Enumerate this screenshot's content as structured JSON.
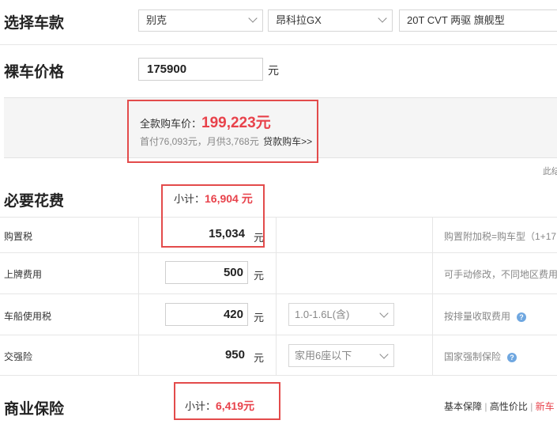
{
  "select_car": {
    "heading": "选择车款",
    "brand": "别克",
    "model": "昂科拉GX",
    "trim": "20T CVT 两驱 旗舰型"
  },
  "bare_price": {
    "heading": "裸车价格",
    "value": "175900",
    "unit": "元"
  },
  "total": {
    "label": "全款购车价：",
    "value": "199,223元",
    "sub": "首付76,093元，月供3,768元",
    "loan_link": "贷款购车>>",
    "side_note": "此结"
  },
  "necessary": {
    "heading": "必要花费",
    "subtotal_label": "小计：",
    "subtotal_value": "16,904 元",
    "rows": [
      {
        "label": "购置税",
        "value": "15,034",
        "unit": "元",
        "note": "购置附加税=购车型（1+17"
      },
      {
        "label": "上牌费用",
        "value": "500",
        "unit": "元",
        "note": "可手动修改，不同地区费用"
      },
      {
        "label": "车船使用税",
        "value": "420",
        "unit": "元",
        "option": "1.0-1.6L(含)",
        "note": "按排量收取费用"
      },
      {
        "label": "交强险",
        "value": "950",
        "unit": "元",
        "option": "家用6座以下",
        "note": "国家强制保险"
      }
    ]
  },
  "commercial": {
    "heading": "商业保险",
    "subtotal_label": "小计：",
    "subtotal_value": "6,419元",
    "plans": [
      "基本保障",
      "高性价比",
      "新车"
    ],
    "sep": "|"
  },
  "colors": {
    "accent_red": "#e8424b",
    "box_red": "#e34b4b",
    "help_blue": "#6fa7e0"
  },
  "icons": [
    "chevron-down-icon",
    "help-icon"
  ]
}
